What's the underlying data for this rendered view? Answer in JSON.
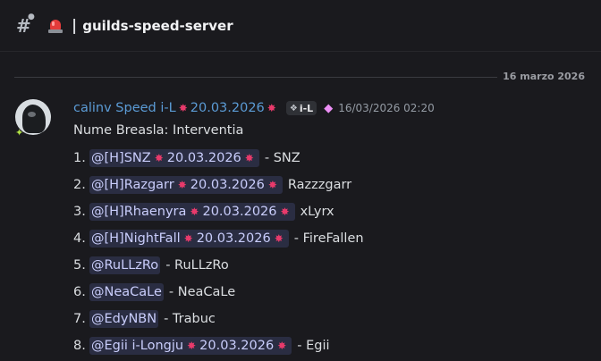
{
  "header": {
    "channel_name": "guilds-speed-server",
    "separator": "|",
    "channel_icon": "hash-lock-icon",
    "emoji": "rotating-light-icon"
  },
  "divider": {
    "date": "16 marzo 2026"
  },
  "message": {
    "author": "calinv Speed i-L",
    "author_date": "20.03.2026",
    "guild_tag": "i-L",
    "timestamp": "16/03/2026 02:20",
    "first_line": "Nume Breasla: Interventia",
    "items": [
      {
        "num": "1.",
        "mention": "@[H]SNZ",
        "date": "20.03.2026",
        "after": "- SNZ"
      },
      {
        "num": "2.",
        "mention": "@[H]Razgarr",
        "date": "20.03.2026",
        "after": "Razzzgarr"
      },
      {
        "num": "3.",
        "mention": "@[H]Rhaenyra",
        "date": "20.03.2026",
        "after": "xLyrx"
      },
      {
        "num": "4.",
        "mention": "@[H]NightFall",
        "date": "20.03.2026",
        "after": "- FireFallen"
      },
      {
        "num": "5.",
        "mention": "@RuLLzRo",
        "date": "",
        "after": "- RuLLzRo"
      },
      {
        "num": "6.",
        "mention": "@NeaCaLe",
        "date": "",
        "after": "- NeaCaLe"
      },
      {
        "num": "7.",
        "mention": "@EdyNBN",
        "date": "",
        "after": "- Trabuc"
      },
      {
        "num": "8.",
        "mention": "@Egii i-Longju",
        "date": "20.03.2026",
        "after": "- Egii"
      }
    ]
  },
  "colors": {
    "background": "#1a1a1e",
    "username": "#5b9bd5",
    "mention_bg": "#2a2d42",
    "mention_text": "#c9cdfb",
    "spark": "#e83a6b"
  }
}
